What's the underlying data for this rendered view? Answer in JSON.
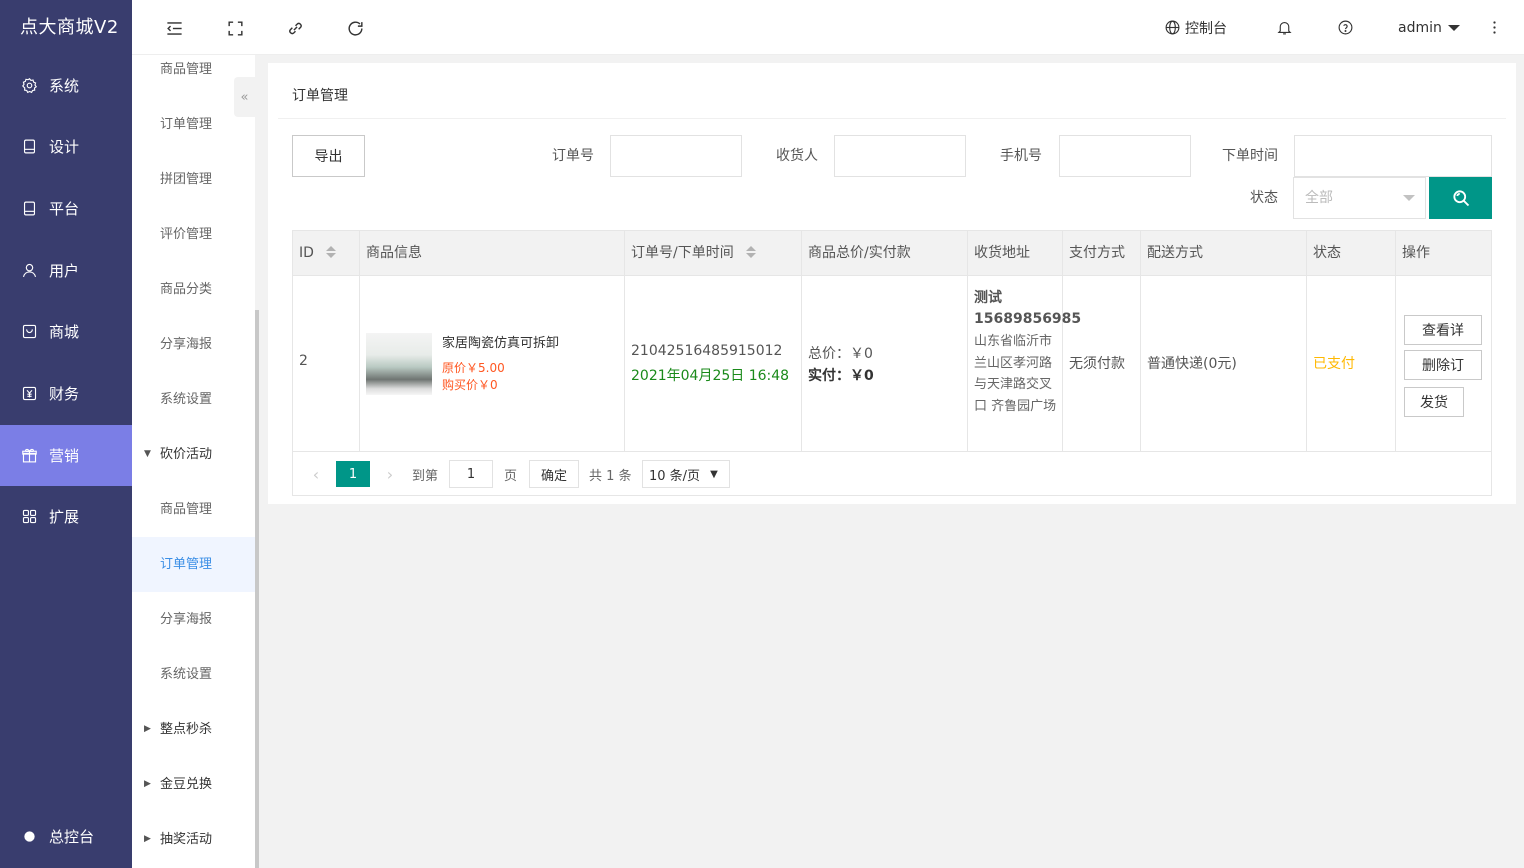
{
  "app": {
    "title": "点大商城V2"
  },
  "sidebar": {
    "items": [
      {
        "label": "系统",
        "icon": "gear-icon"
      },
      {
        "label": "设计",
        "icon": "tablet-icon"
      },
      {
        "label": "平台",
        "icon": "tablet-icon"
      },
      {
        "label": "用户",
        "icon": "user-icon"
      },
      {
        "label": "商城",
        "icon": "shop-icon"
      },
      {
        "label": "财务",
        "icon": "finance-icon"
      },
      {
        "label": "营销",
        "icon": "gift-icon",
        "active": true
      },
      {
        "label": "扩展",
        "icon": "grid-icon"
      }
    ],
    "bottom": {
      "label": "总控台",
      "icon": "gear-icon"
    }
  },
  "subsidebar": {
    "items": [
      {
        "label": "商品管理"
      },
      {
        "label": "订单管理"
      },
      {
        "label": "拼团管理"
      },
      {
        "label": "评价管理"
      },
      {
        "label": "商品分类"
      },
      {
        "label": "分享海报"
      },
      {
        "label": "系统设置"
      },
      {
        "label": "砍价活动",
        "group": true,
        "expanded": true
      },
      {
        "label": "商品管理"
      },
      {
        "label": "订单管理",
        "active": true
      },
      {
        "label": "分享海报"
      },
      {
        "label": "系统设置"
      },
      {
        "label": "整点秒杀",
        "group": true
      },
      {
        "label": "金豆兑换",
        "group": true
      },
      {
        "label": "抽奖活动",
        "group": true
      }
    ],
    "collapse_icon": "«"
  },
  "header": {
    "console": "控制台",
    "user": "admin"
  },
  "page": {
    "title": "订单管理",
    "export_label": "导出",
    "filters": {
      "order_no": "订单号",
      "receiver": "收货人",
      "phone": "手机号",
      "order_time": "下单时间",
      "status": "状态",
      "status_value": "全部"
    }
  },
  "table": {
    "columns": [
      "ID",
      "商品信息",
      "订单号/下单时间",
      "商品总价/实付款",
      "收货地址",
      "支付方式",
      "配送方式",
      "状态",
      "操作"
    ],
    "rows": [
      {
        "id": "2",
        "product_name": "家居陶瓷仿真可拆卸",
        "orig_price": "原价￥5.00",
        "buy_price": "购买价￥0",
        "order_no": "21042516485915012",
        "order_time": "2021年04月25日 16:48",
        "total_label": "总价：",
        "total_value": "￥0",
        "paid_label": "实付：",
        "paid_value": "￥0",
        "addr_name": "测试 15689856985",
        "addr_text": "山东省临沂市兰山区孝河路与天津路交叉口 齐鲁园广场",
        "pay_method": "无须付款",
        "delivery": "普通快递(0元)",
        "status": "已支付",
        "actions": [
          "查看详",
          "删除订",
          "发货"
        ]
      }
    ]
  },
  "pager": {
    "current": "1",
    "goto_label": "到第",
    "goto_value": "1",
    "page_unit": "页",
    "confirm": "确定",
    "total": "共 1 条",
    "page_size": "10 条/页"
  },
  "colors": {
    "sidebar_bg": "#393d6e",
    "sidebar_active": "#7b7ee6",
    "primary": "#009688",
    "price": "#ff5722",
    "time": "#1a8a1a",
    "status_paid": "#ffb800"
  }
}
